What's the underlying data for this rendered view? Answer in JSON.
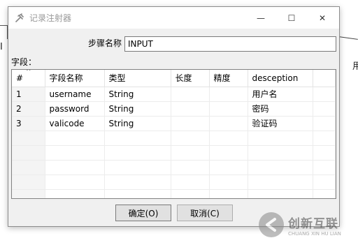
{
  "background": {
    "left_glyph": "Ⅰ",
    "right_glyph": "用"
  },
  "window": {
    "title": "记录注射器",
    "minimize": "—",
    "maximize": "☐",
    "close": "✕"
  },
  "step": {
    "label": "步骤名称",
    "value": "INPUT"
  },
  "fields": {
    "label": "字段：",
    "columns": [
      "#",
      "字段名称",
      "类型",
      "长度",
      "精度",
      "desception"
    ],
    "rows": [
      [
        "1",
        "username",
        "String",
        "",
        "",
        "用户名"
      ],
      [
        "2",
        "password",
        "String",
        "",
        "",
        "密码"
      ],
      [
        "3",
        "valicode",
        "String",
        "",
        "",
        "验证码"
      ],
      [
        "",
        "",
        "",
        "",
        "",
        ""
      ],
      [
        "",
        "",
        "",
        "",
        "",
        ""
      ],
      [
        "",
        "",
        "",
        "",
        "",
        ""
      ],
      [
        "",
        "",
        "",
        "",
        "",
        ""
      ],
      [
        "",
        "",
        "",
        "",
        "",
        ""
      ]
    ]
  },
  "buttons": {
    "ok": "确定(O)",
    "cancel": "取消(C)"
  },
  "watermark": {
    "cn": "创新互联",
    "en": "CHUANG XIN HU LIAN"
  },
  "colors": {
    "dialog_bg": "#f0f0f0",
    "title_text": "#999999",
    "button_bg": "#e1e1e1"
  }
}
